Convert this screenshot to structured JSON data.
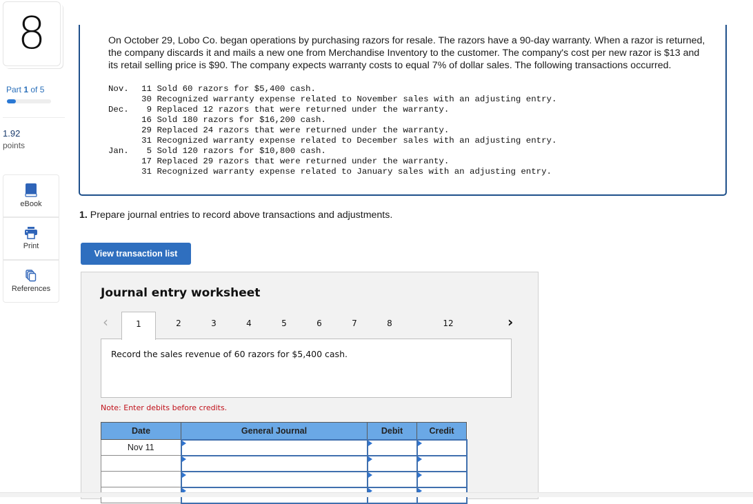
{
  "sidebar": {
    "question_number": "8",
    "part": {
      "prefix": "Part ",
      "current": "1",
      "suffix": " of 5",
      "progress_fraction": 0.2
    },
    "points_value": "1.92",
    "points_label": "points",
    "tools": [
      {
        "label": "eBook",
        "icon": "book-icon"
      },
      {
        "label": "Print",
        "icon": "printer-icon"
      },
      {
        "label": "References",
        "icon": "references-icon"
      }
    ]
  },
  "problem": {
    "text": "On October 29, Lobo Co. began operations by purchasing razors for resale. The razors have a 90-day warranty. When a razor is returned, the company discards it and mails a new one from Merchandise Inventory to the customer. The company's cost per new razor is $13 and its retail selling price is $90. The company expects warranty costs to equal 7%  of dollar sales. The following transactions occurred.",
    "transactions": [
      {
        "month": "Nov.",
        "day": "11",
        "text": "Sold 60 razors for $5,400 cash."
      },
      {
        "month": "",
        "day": "30",
        "text": "Recognized warranty expense related to November sales with an adjusting entry."
      },
      {
        "month": "Dec.",
        "day": "9",
        "text": "Replaced 12 razors that were returned under the warranty."
      },
      {
        "month": "",
        "day": "16",
        "text": "Sold 180 razors for $16,200 cash."
      },
      {
        "month": "",
        "day": "29",
        "text": "Replaced 24 razors that were returned under the warranty."
      },
      {
        "month": "",
        "day": "31",
        "text": "Recognized warranty expense related to December sales with an adjusting entry."
      },
      {
        "month": "Jan.",
        "day": "5",
        "text": "Sold 120 razors for $10,800 cash."
      },
      {
        "month": "",
        "day": "17",
        "text": "Replaced 29 razors that were returned under the warranty."
      },
      {
        "month": "",
        "day": "31",
        "text": "Recognized warranty expense related to January sales with an adjusting entry."
      }
    ]
  },
  "instruction": {
    "number": "1.",
    "text": " Prepare journal entries to record above transactions and adjustments."
  },
  "view_transaction_button": "View transaction list",
  "worksheet": {
    "title": "Journal entry worksheet",
    "prev_glyph": "‹",
    "next_glyph": "›",
    "tabs": [
      "1",
      "2",
      "3",
      "4",
      "5",
      "6",
      "7",
      "8",
      "12"
    ],
    "active_tab": "1",
    "prompt": "Record the sales revenue of 60 razors for $5,400 cash.",
    "note": "Note: Enter debits before credits.",
    "columns": [
      "Date",
      "General Journal",
      "Debit",
      "Credit"
    ],
    "rows": [
      {
        "date": "Nov 11",
        "account": "",
        "debit": "",
        "credit": ""
      },
      {
        "date": "",
        "account": "",
        "debit": "",
        "credit": ""
      },
      {
        "date": "",
        "account": "",
        "debit": "",
        "credit": ""
      },
      {
        "date": "",
        "account": "",
        "debit": "",
        "credit": ""
      }
    ]
  }
}
